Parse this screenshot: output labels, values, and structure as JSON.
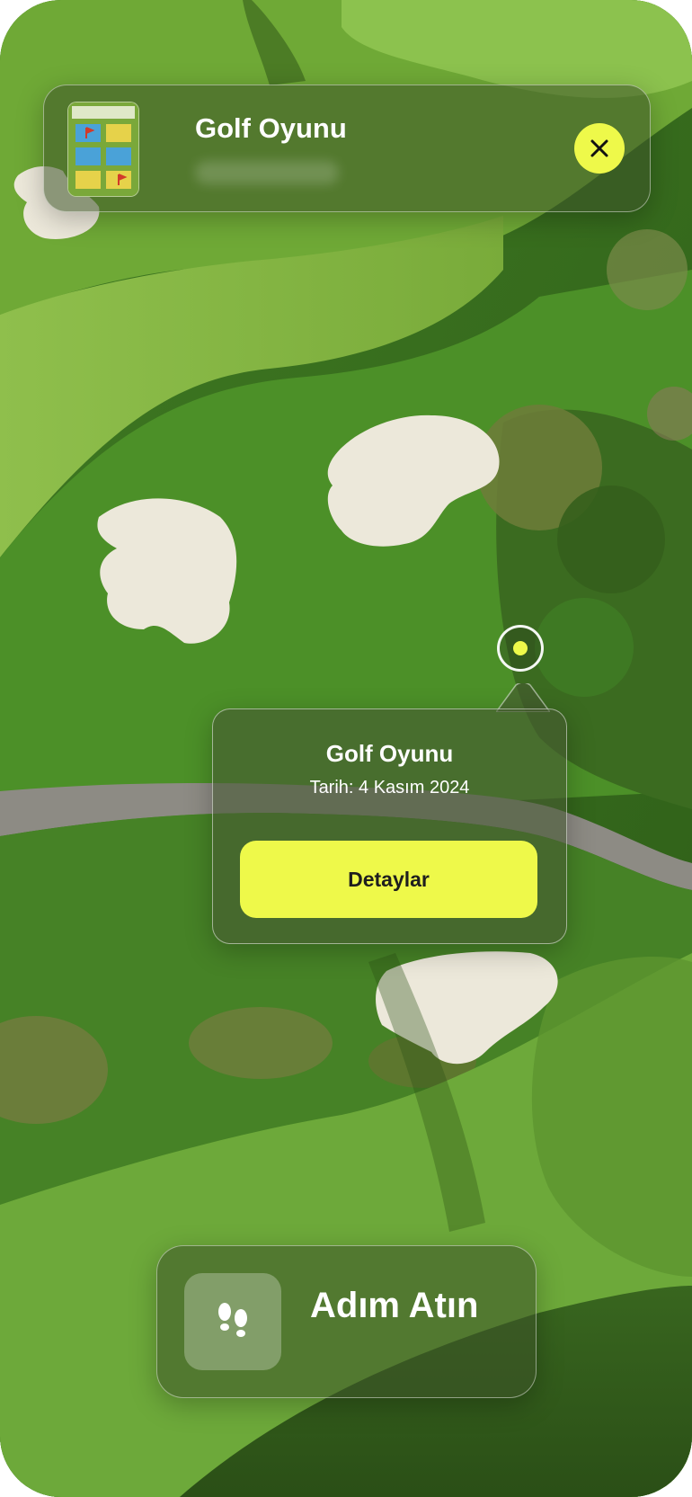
{
  "top_card": {
    "title": "Golf Oyunu",
    "thumbnail_icon": "golf-map-thumbnail",
    "close_icon": "close-icon"
  },
  "map": {
    "pin_icon": "location-pin-icon"
  },
  "popup": {
    "title": "Golf Oyunu",
    "date": "Tarih: 4 Kasım 2024",
    "button_label": "Detaylar"
  },
  "bottom_card": {
    "label": "Adım Atın",
    "icon": "footsteps-icon"
  },
  "colors": {
    "accent": "#eef94a",
    "glass": "#3c5228",
    "grass": "#4f8a2a",
    "fairway": "#86b644",
    "sand": "#e8e4d6"
  }
}
